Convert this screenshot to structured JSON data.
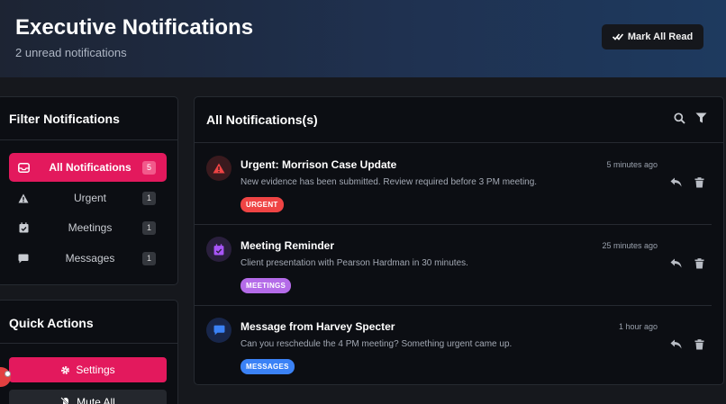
{
  "header": {
    "title": "Executive Notifications",
    "subtitle": "2 unread notifications",
    "mark_all_label": "Mark All Read"
  },
  "filters": {
    "title": "Filter Notifications",
    "items": [
      {
        "label": "All Notifications",
        "count": "5",
        "icon": "inbox-icon"
      },
      {
        "label": "Urgent",
        "count": "1",
        "icon": "warning-icon"
      },
      {
        "label": "Meetings",
        "count": "1",
        "icon": "calendar-check-icon"
      },
      {
        "label": "Messages",
        "count": "1",
        "icon": "chat-bubble-icon"
      }
    ]
  },
  "quick_actions": {
    "title": "Quick Actions",
    "settings_label": "Settings",
    "mute_label": "Mute All"
  },
  "list": {
    "title": "All Notifications(s)",
    "notifications": [
      {
        "title": "Urgent: Morrison Case Update",
        "time": "5 minutes ago",
        "text": "New evidence has been submitted. Review required before 3 PM meeting.",
        "tag": "URGENT",
        "tag_color": "#ef4444",
        "icon": "warning-icon",
        "icon_color": "#ef4444"
      },
      {
        "title": "Meeting Reminder",
        "time": "25 minutes ago",
        "text": "Client presentation with Pearson Hardman in 30 minutes.",
        "tag": "MEETINGS",
        "tag_color": "#b46be8",
        "icon": "calendar-check-icon",
        "icon_color": "#a855f7"
      },
      {
        "title": "Message from Harvey Specter",
        "time": "1 hour ago",
        "text": "Can you reschedule the 4 PM meeting? Something urgent came up.",
        "tag": "MESSAGES",
        "tag_color": "#3b82f6",
        "icon": "chat-bubble-icon",
        "icon_color": "#3b82f6"
      }
    ]
  },
  "colors": {
    "accent": "#e3195d",
    "urgent": "#ef4444",
    "meetings": "#a855f7",
    "messages": "#3b82f6"
  }
}
